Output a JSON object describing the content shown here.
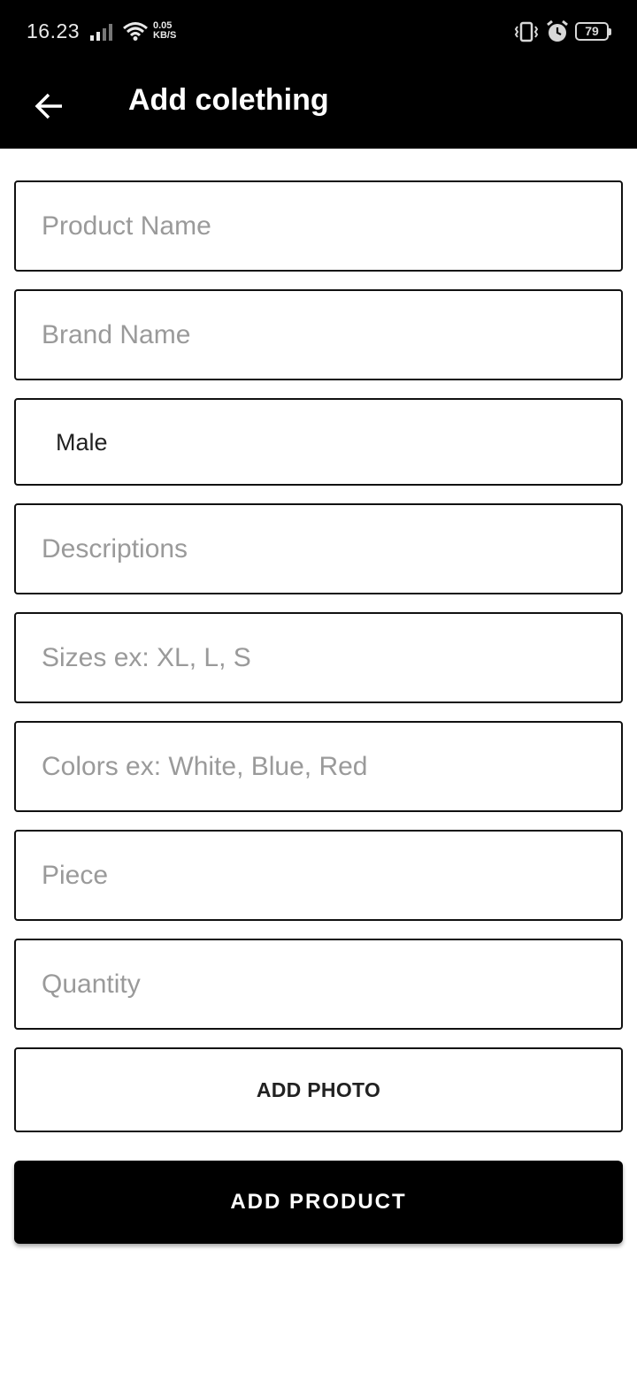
{
  "status_bar": {
    "time": "16.23",
    "net_speed_value": "0.05",
    "net_speed_unit": "KB/S",
    "battery_level": "79",
    "icons": [
      "signal-icon",
      "wifi-icon",
      "vibrate-icon",
      "alarm-icon",
      "battery-icon"
    ]
  },
  "app_bar": {
    "title": "Add colething",
    "back_icon": "arrow-left-icon"
  },
  "form": {
    "product_name": {
      "placeholder": "Product Name",
      "value": ""
    },
    "brand_name": {
      "placeholder": "Brand Name",
      "value": ""
    },
    "gender": {
      "selected": "Male"
    },
    "descriptions": {
      "placeholder": "Descriptions",
      "value": ""
    },
    "sizes": {
      "placeholder": "Sizes ex: XL, L, S",
      "value": ""
    },
    "colors": {
      "placeholder": "Colors ex: White, Blue, Red",
      "value": ""
    },
    "piece": {
      "placeholder": "Piece",
      "value": ""
    },
    "quantity": {
      "placeholder": "Quantity",
      "value": ""
    }
  },
  "buttons": {
    "add_photo": "ADD PHOTO",
    "add_product": "ADD PRODUCT"
  },
  "colors": {
    "bar_background": "#000000",
    "page_background": "#ffffff",
    "border": "#111111",
    "placeholder_text": "#9a9a9a",
    "primary_button": "#000000"
  }
}
